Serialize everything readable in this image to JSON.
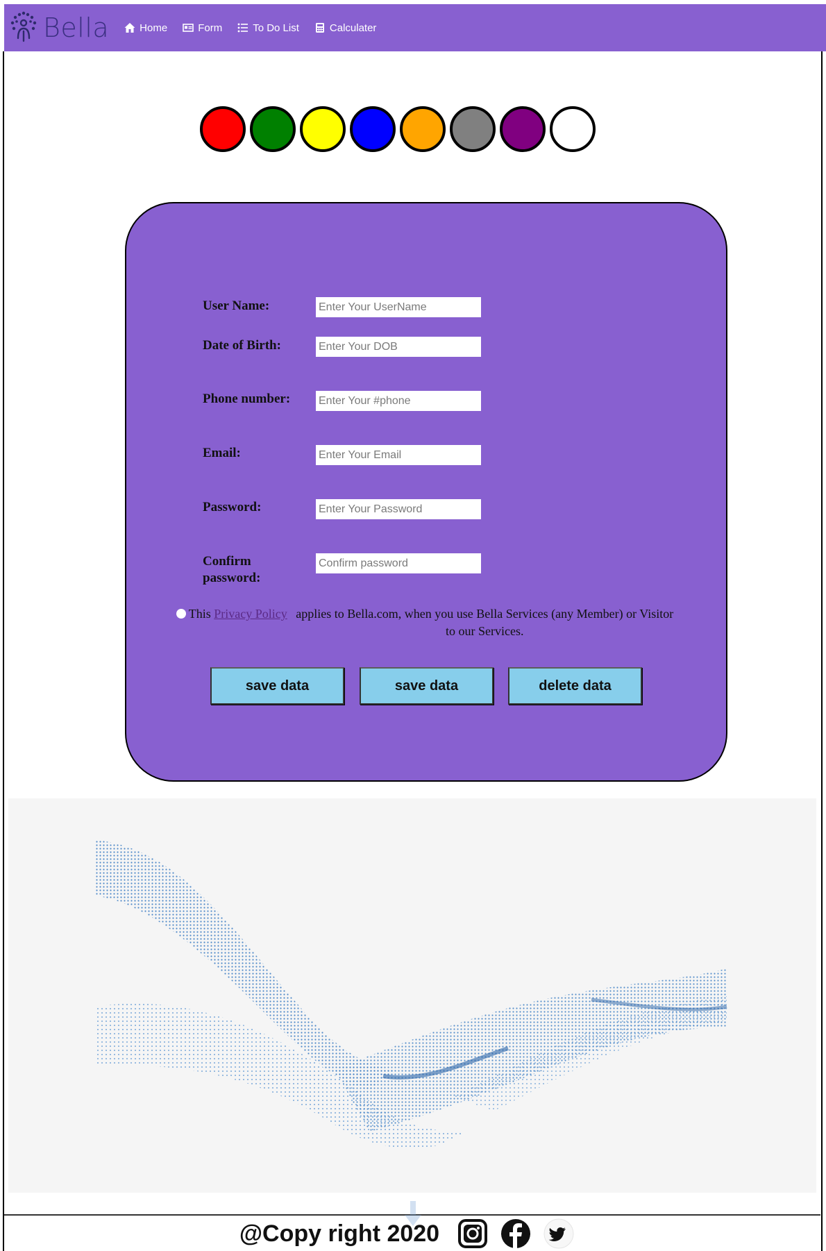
{
  "brand": {
    "name": "Bella"
  },
  "nav": {
    "items": [
      {
        "label": "Home",
        "icon": "home-icon"
      },
      {
        "label": "Form",
        "icon": "id-card-icon"
      },
      {
        "label": "To Do List",
        "icon": "list-icon"
      },
      {
        "label": "Calculater",
        "icon": "calculator-icon"
      }
    ]
  },
  "colors": [
    "#ff0000",
    "#008000",
    "#ffff00",
    "#0000ff",
    "#ffa500",
    "#808080",
    "#800080",
    "#ffffff"
  ],
  "form": {
    "fields": [
      {
        "label": "User Name:",
        "placeholder": "Enter Your UserName"
      },
      {
        "label": "Date of Birth:",
        "placeholder": "Enter Your DOB"
      },
      {
        "label": "Phone number:",
        "placeholder": "Enter Your #phone"
      },
      {
        "label": "Email:",
        "placeholder": "Enter Your Email"
      },
      {
        "label": "Password:",
        "placeholder": "Enter Your Password"
      },
      {
        "label": "Confirm password:",
        "placeholder": "Confirm password"
      }
    ],
    "privacy": {
      "prefix": "This",
      "link": "Privacy Policy",
      "suffix": "applies to Bella.com, when you use Bella Services (any Member) or Visitor to our Services."
    },
    "buttons": [
      "save data",
      "save data",
      "delete data"
    ]
  },
  "footer": {
    "copyright": "@Copy right 2020",
    "social": [
      "instagram-icon",
      "facebook-icon",
      "twitter-icon"
    ]
  },
  "theme": {
    "primary": "#8860d0",
    "button": "#87ceeb"
  }
}
